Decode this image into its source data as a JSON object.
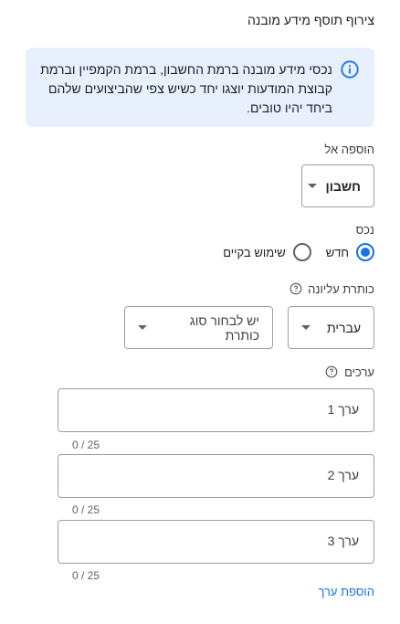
{
  "page": {
    "title": "צירוף תוסף מידע מובנה"
  },
  "info": {
    "text": "נכסי מידע מובנה ברמת החשבון, ברמת הקמפיין וברמת קבוצת המודעות יוצגו יחד כשיש צפי שהביצועים שלהם ביחד יהיו טובים.",
    "icon": "info-icon",
    "accent": "#1a73e8",
    "background": "#e8f0fe"
  },
  "add_to": {
    "label": "הוספה אל",
    "selected": "חשבון"
  },
  "asset": {
    "label": "נכס",
    "options": [
      {
        "label": "חדש",
        "checked": true
      },
      {
        "label": "שימוש בקיים",
        "checked": false
      }
    ]
  },
  "header": {
    "label": "כותרת עליונה",
    "language": "עברית",
    "type_placeholder": "יש לבחור סוג כותרת"
  },
  "values": {
    "label": "ערכים",
    "items": [
      {
        "placeholder": "ערך 1",
        "counter": "0 / 25"
      },
      {
        "placeholder": "ערך 2",
        "counter": "0 / 25"
      },
      {
        "placeholder": "ערך 3",
        "counter": "0 / 25"
      }
    ],
    "add_label": "הוספת ערך"
  }
}
